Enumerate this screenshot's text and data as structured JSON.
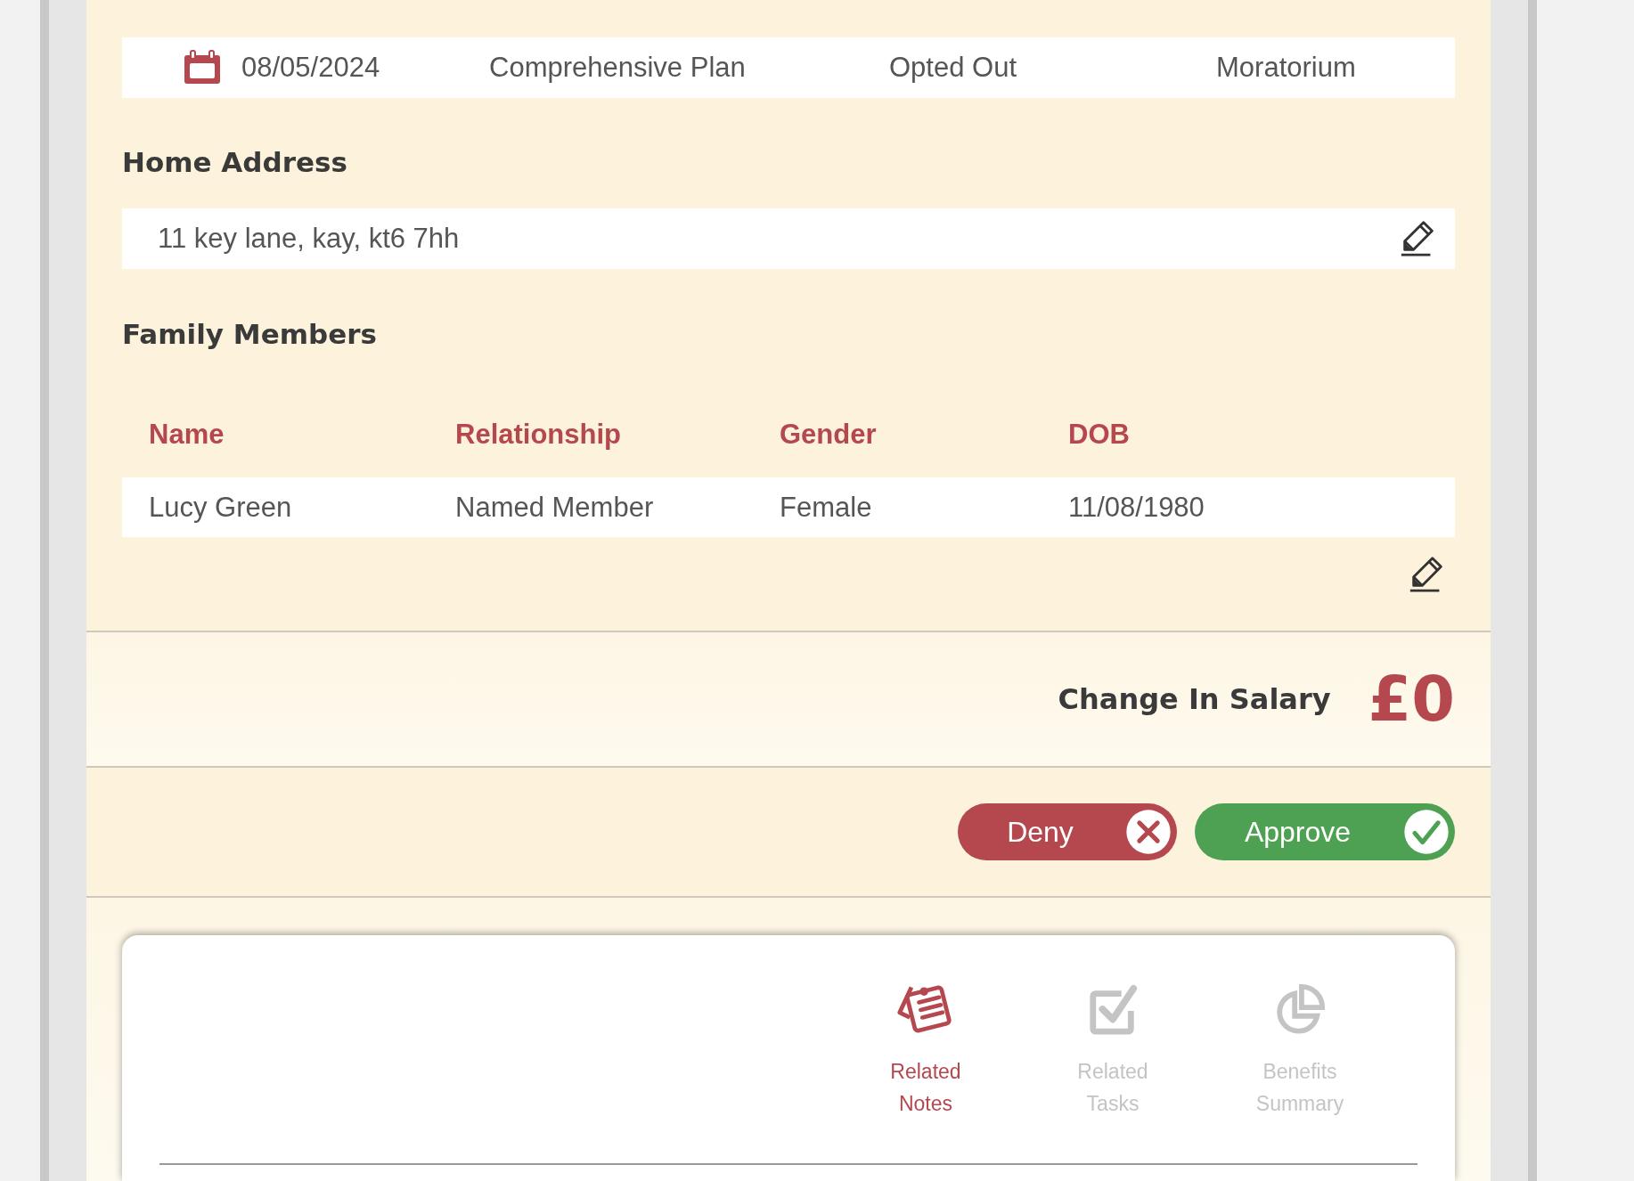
{
  "plan_row": {
    "date": "08/05/2024",
    "plan": "Comprehensive Plan",
    "opt_status": "Opted Out",
    "status": "Moratorium"
  },
  "home_address": {
    "heading": "Home Address",
    "value": "11 key lane, kay, kt6 7hh"
  },
  "family_members": {
    "heading": "Family Members",
    "columns": [
      "Name",
      "Relationship",
      "Gender",
      "DOB"
    ],
    "rows": [
      [
        "Lucy Green",
        "Named Member",
        "Female",
        "11/08/1980"
      ]
    ]
  },
  "salary": {
    "label": "Change In Salary",
    "value": "£0"
  },
  "actions": [
    {
      "label": "Deny",
      "kind": "deny"
    },
    {
      "label": "Approve",
      "kind": "approve"
    }
  ],
  "tabs": [
    {
      "label": "Related Notes",
      "kind": "notes",
      "selected": true
    },
    {
      "label": "Related Tasks",
      "kind": "tasks",
      "selected": false
    },
    {
      "label": "Benefits Summary",
      "kind": "summary",
      "selected": false
    }
  ]
}
